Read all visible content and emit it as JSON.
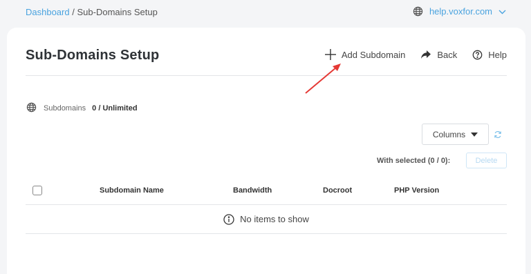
{
  "breadcrumb": {
    "home": "Dashboard",
    "separator": "/",
    "current": "Sub-Domains Setup"
  },
  "domain_picker": {
    "domain": "help.voxfor.com",
    "icon": "globe-icon",
    "dropdown_icon": "chevron-down-icon"
  },
  "page": {
    "title": "Sub-Domains Setup"
  },
  "actions": {
    "add": "Add Subdomain",
    "back": "Back",
    "help": "Help"
  },
  "counter": {
    "label": "Subdomains",
    "value": "0 / Unlimited"
  },
  "toolbar": {
    "columns": "Columns",
    "with_selected": "With selected (0 / 0):",
    "delete": "Delete"
  },
  "table": {
    "headers": [
      "Subdomain Name",
      "Bandwidth",
      "Docroot",
      "PHP Version"
    ],
    "empty_message": "No items to show"
  },
  "colors": {
    "accent": "#4aa3df",
    "annotation_arrow": "#e53935",
    "background": "#f4f5f7",
    "card": "#ffffff"
  }
}
